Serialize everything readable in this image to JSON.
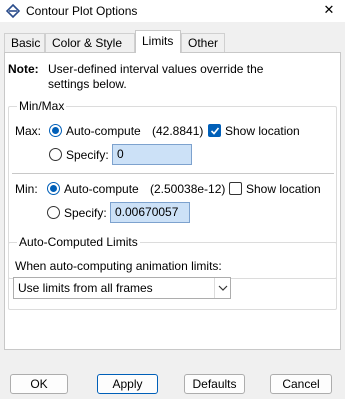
{
  "window": {
    "title": "Contour Plot Options"
  },
  "tabs": [
    {
      "label": "Basic"
    },
    {
      "label": "Color & Style"
    },
    {
      "label": "Limits"
    },
    {
      "label": "Other"
    }
  ],
  "note": {
    "label": "Note:",
    "text": "User-defined interval values override the settings below."
  },
  "minmax": {
    "title": "Min/Max",
    "max": {
      "label": "Max:",
      "auto_label": "Auto-compute",
      "auto_value": "(42.8841)",
      "show_location_label": "Show location",
      "show_location_checked": true,
      "specify_label": "Specify:",
      "specify_value": "0"
    },
    "min": {
      "label": "Min:",
      "auto_label": "Auto-compute",
      "auto_value": "(2.50038e-12)",
      "show_location_label": "Show location",
      "show_location_checked": false,
      "specify_label": "Specify:",
      "specify_value": "0.00670057"
    }
  },
  "autolimits": {
    "title": "Auto-Computed Limits",
    "prompt": "When auto-computing animation limits:",
    "selected": "Use limits from all frames"
  },
  "buttons": {
    "ok": "OK",
    "apply": "Apply",
    "defaults": "Defaults",
    "cancel": "Cancel"
  },
  "colors": {
    "accent": "#005fb8",
    "field_bg": "#cce1f7"
  }
}
